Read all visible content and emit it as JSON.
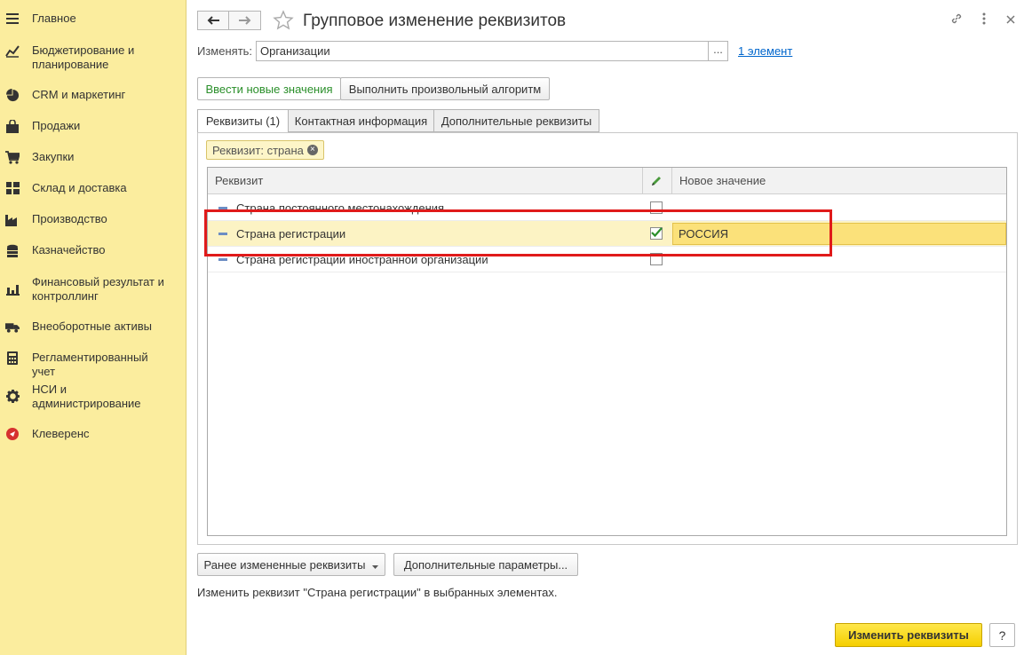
{
  "sidebar": {
    "items": [
      {
        "label": "Главное",
        "icon": "menu-icon"
      },
      {
        "label": "Бюджетирование и планирование",
        "icon": "budget-chart-icon"
      },
      {
        "label": "CRM и маркетинг",
        "icon": "pie-chart-icon"
      },
      {
        "label": "Продажи",
        "icon": "shopping-bag-icon"
      },
      {
        "label": "Закупки",
        "icon": "cart-icon"
      },
      {
        "label": "Склад и доставка",
        "icon": "warehouse-icon"
      },
      {
        "label": "Производство",
        "icon": "factory-icon"
      },
      {
        "label": "Казначейство",
        "icon": "coins-icon"
      },
      {
        "label": "Финансовый результат и контроллинг",
        "icon": "bar-chart-icon"
      },
      {
        "label": "Внеоборотные активы",
        "icon": "truck-icon"
      },
      {
        "label": "Регламентированный учет",
        "icon": "calculator-icon"
      },
      {
        "label": "НСИ и администрирование",
        "icon": "gear-icon"
      },
      {
        "label": "Клеверенс",
        "icon": "cleverence-icon"
      }
    ]
  },
  "header": {
    "title": "Групповое изменение реквизитов",
    "back_icon": "arrow-left-icon",
    "forward_icon": "arrow-right-icon",
    "favorite_icon": "star-icon",
    "link_icon": "link-icon",
    "more_icon": "more-vertical-icon",
    "close_icon": "close-icon"
  },
  "change_field": {
    "label": "Изменять:",
    "value": "Организации",
    "select_btn": "...",
    "count_link": "1 элемент"
  },
  "mode_buttons": {
    "new_values": "Ввести новые значения",
    "algorithm": "Выполнить произвольный алгоритм"
  },
  "tabs": [
    {
      "label": "Реквизиты (1)",
      "active": true
    },
    {
      "label": "Контактная информация",
      "active": false
    },
    {
      "label": "Дополнительные реквизиты",
      "active": false
    }
  ],
  "filter": {
    "label": "Реквизит: страна"
  },
  "grid": {
    "columns": {
      "attribute": "Реквизит",
      "edit_icon": "pencil-icon",
      "new_value": "Новое значение"
    },
    "rows": [
      {
        "name": "Страна постоянного местонахождения",
        "checked": false,
        "value": ""
      },
      {
        "name": "Страна регистрации",
        "checked": true,
        "value": "РОССИЯ"
      },
      {
        "name": "Страна регистрации иностранной организации",
        "checked": false,
        "value": ""
      }
    ]
  },
  "bottom": {
    "previous_btn": "Ранее измененные реквизиты",
    "params_btn": "Дополнительные параметры...",
    "status_text": "Изменить реквизит \"Страна регистрации\" в выбранных элементах.",
    "apply_btn": "Изменить реквизиты",
    "help_btn": "?"
  },
  "colors": {
    "sidebar_bg": "#fbed9e",
    "selected_row": "#fcf3c4",
    "value_cell": "#fbe17a",
    "primary_btn": "#f5cf00",
    "highlight_box": "#e01a1a",
    "link": "#0066cc"
  }
}
